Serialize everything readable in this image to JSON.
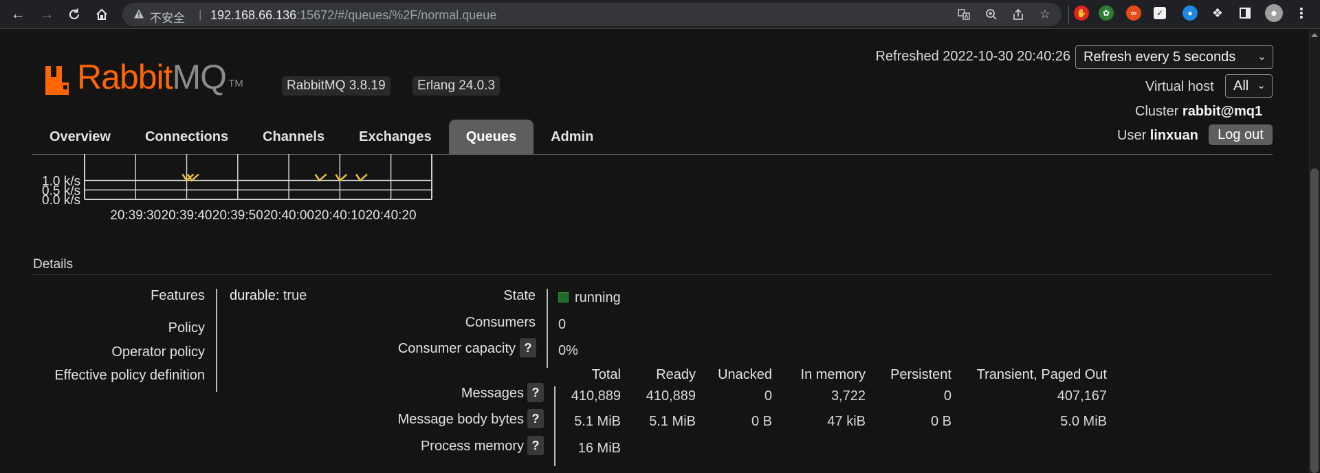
{
  "browser": {
    "insecure_label": "不安全",
    "url_host": "192.168.66.136",
    "url_rest": ":15672/#/queues/%2F/normal.queue"
  },
  "header": {
    "logo_rabbit": "Rabbit",
    "logo_mq": "MQ",
    "logo_tm": "TM",
    "version_badge": "RabbitMQ 3.8.19",
    "erlang_badge": "Erlang 24.0.3",
    "refreshed": "Refreshed 2022-10-30 20:40:26",
    "refresh_select": "Refresh every 5 seconds",
    "vhost_label": "Virtual host",
    "vhost_select": "All",
    "cluster_label": "Cluster",
    "cluster_value": "rabbit@mq1",
    "user_label": "User",
    "user_value": "linxuan",
    "logout_label": "Log out"
  },
  "tabs": [
    {
      "label": "Overview"
    },
    {
      "label": "Connections"
    },
    {
      "label": "Channels"
    },
    {
      "label": "Exchanges"
    },
    {
      "label": "Queues",
      "active": true
    },
    {
      "label": "Admin"
    }
  ],
  "chart_data": {
    "type": "line",
    "title": "",
    "xlabel": "",
    "ylabel": "",
    "y_tick_labels": [
      "1.0 k/s",
      "0.5 k/s",
      "0.0 k/s"
    ],
    "y_ticks": [
      1.0,
      0.5,
      0.0
    ],
    "x_tick_labels": [
      "20:39:30",
      "20:39:40",
      "20:39:50",
      "20:40:00",
      "20:40:10",
      "20:40:20"
    ],
    "ylim": [
      0,
      1.2
    ],
    "grid": true,
    "series": [
      {
        "color": "#edc240",
        "x": [
          "20:39:40",
          "20:39:41",
          "20:40:06",
          "20:40:10",
          "20:40:14"
        ],
        "y": [
          1.0,
          1.0,
          1.0,
          0.99,
          1.0
        ]
      }
    ]
  },
  "details": {
    "title": "Details",
    "features_label": "Features",
    "durable_key": "durable:",
    "durable_value": "true",
    "policy_label": "Policy",
    "operator_policy_label": "Operator policy",
    "effective_policy_label": "Effective policy definition",
    "state_label": "State",
    "state_value": "running",
    "state_color": "#1f6b2a",
    "consumers_label": "Consumers",
    "consumers_value": "0",
    "consumer_capacity_label": "Consumer capacity",
    "consumer_capacity_value": "0%",
    "help_glyph": "?"
  },
  "stats": {
    "columns": [
      "Total",
      "Ready",
      "Unacked",
      "In memory",
      "Persistent",
      "Transient, Paged Out"
    ],
    "rows": [
      {
        "label": "Messages",
        "values": [
          "410,889",
          "410,889",
          "0",
          "3,722",
          "0",
          "407,167"
        ]
      },
      {
        "label": "Message body bytes",
        "values": [
          "5.1 MiB",
          "5.1 MiB",
          "0 B",
          "47 kiB",
          "0 B",
          "5.0 MiB"
        ]
      },
      {
        "label": "Process memory",
        "values": [
          "16 MiB"
        ]
      }
    ]
  }
}
